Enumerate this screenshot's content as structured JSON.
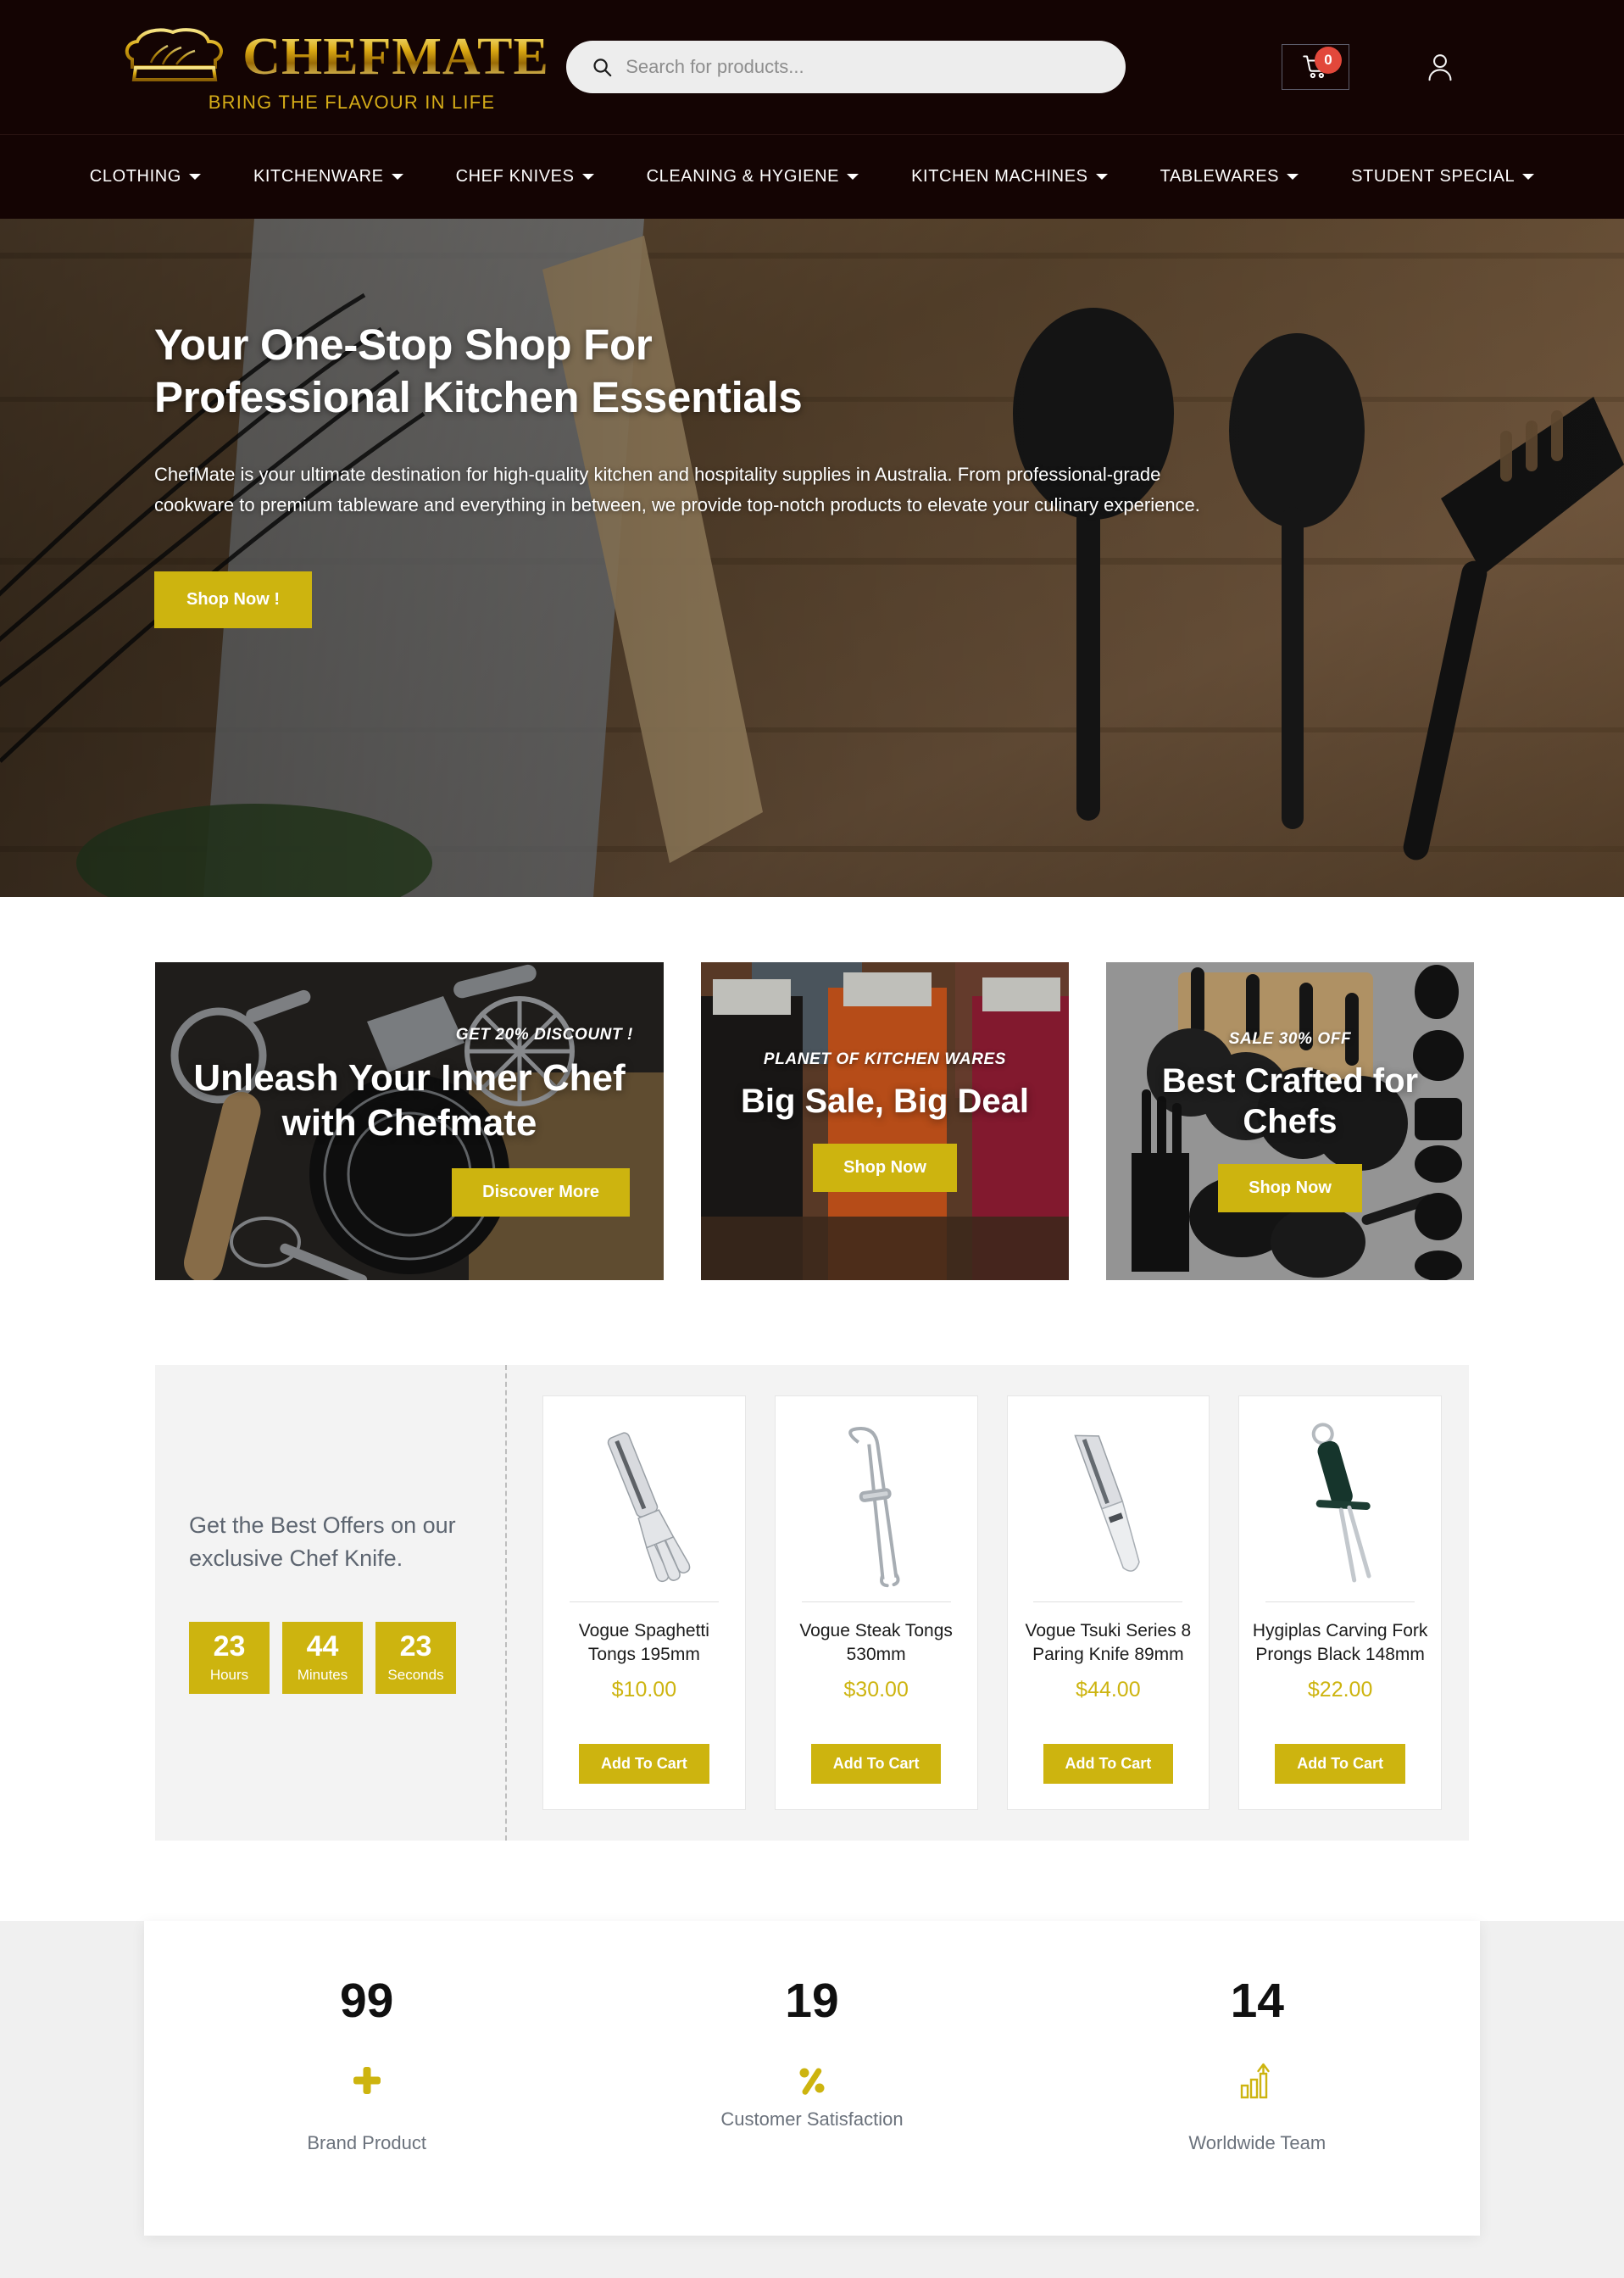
{
  "header": {
    "logo": {
      "icon": "chef-hat-icon",
      "name": "CHEFMATE",
      "tagline": "BRING THE FLAVOUR IN LIFE"
    },
    "search": {
      "icon": "search-icon",
      "placeholder": "Search for products...",
      "value": ""
    },
    "cart": {
      "icon": "shopping-cart-icon",
      "count": "0"
    },
    "account": {
      "icon": "user-account-icon"
    },
    "nav": [
      {
        "label": "CLOTHING"
      },
      {
        "label": "KITCHENWARE"
      },
      {
        "label": "CHEF KNIVES"
      },
      {
        "label": "CLEANING & HYGIENE"
      },
      {
        "label": "KITCHEN MACHINES"
      },
      {
        "label": "TABLEWARES"
      },
      {
        "label": "STUDENT SPECIAL"
      }
    ]
  },
  "hero": {
    "title": "Your One-Stop Shop For Professional Kitchen Essentials",
    "description": "ChefMate is your ultimate destination for high-quality kitchen and hospitality supplies in Australia. From professional-grade cookware to premium tableware and everything in between, we provide top-notch products to elevate your culinary experience.",
    "cta": "Shop Now !"
  },
  "promos": [
    {
      "eyebrow": "GET 20% DISCOUNT !",
      "title": "Unleash Your Inner Chef with Chefmate",
      "cta": "Discover More"
    },
    {
      "eyebrow": "PLANET OF KITCHEN WARES",
      "title": "Big Sale, Big Deal",
      "cta": "Shop Now"
    },
    {
      "eyebrow": "SALE 30% OFF",
      "title": "Best Crafted for Chefs",
      "cta": "Shop Now"
    }
  ],
  "deal": {
    "heading": "Get the Best Offers on our exclusive Chef Knife.",
    "countdown": [
      {
        "value": "23",
        "label": "Hours"
      },
      {
        "value": "44",
        "label": "Minutes"
      },
      {
        "value": "23",
        "label": "Seconds"
      }
    ],
    "products": [
      {
        "name": "Vogue Spaghetti Tongs 195mm",
        "price": "$10.00",
        "cta": "Add To Cart",
        "image": "spaghetti-tongs-image"
      },
      {
        "name": "Vogue Steak Tongs 530mm",
        "price": "$30.00",
        "cta": "Add To Cart",
        "image": "steak-tongs-image"
      },
      {
        "name": "Vogue Tsuki Series 8 Paring Knife 89mm",
        "price": "$44.00",
        "cta": "Add To Cart",
        "image": "paring-knife-image"
      },
      {
        "name": "Hygiplas Carving Fork Prongs Black 148mm",
        "price": "$22.00",
        "cta": "Add To Cart",
        "image": "carving-fork-image"
      }
    ]
  },
  "stats": [
    {
      "value": "99",
      "icon": "plus-icon",
      "label": "Brand Product"
    },
    {
      "value": "19",
      "icon": "percent-icon",
      "label": "Customer Satisfaction"
    },
    {
      "value": "14",
      "icon": "growth-chart-icon",
      "label": "Worldwide Team"
    }
  ],
  "colors": {
    "gold": "#cdb40f",
    "header_bg": "#140403",
    "badge_red": "#e2483b",
    "text_grey": "#6b727c"
  }
}
